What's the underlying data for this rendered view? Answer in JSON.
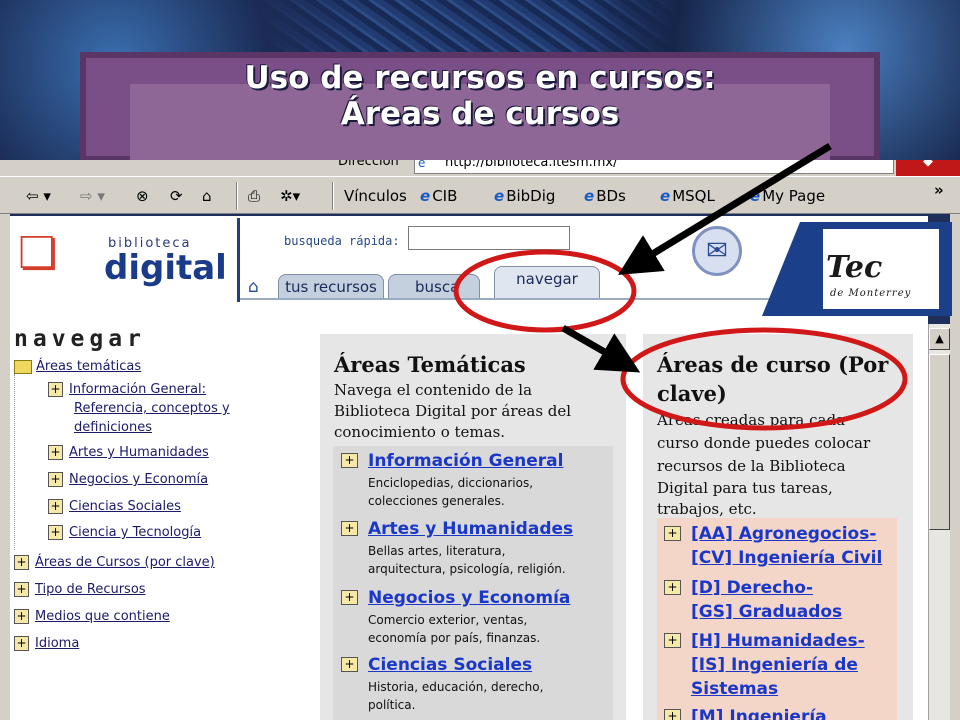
{
  "slide": {
    "title_line1": "Uso de recursos en cursos:",
    "title_line2": "Áreas de cursos"
  },
  "browser": {
    "address_label": "Dirección",
    "address_url": "http://biblioteca.itesm.mx/",
    "toolbar": {
      "links_label": "Vínculos",
      "links": [
        "CIB",
        "BibDig",
        "BDs",
        "MSQL",
        "My Page"
      ],
      "more": "»"
    }
  },
  "header": {
    "logo_small": "biblioteca",
    "logo_big": "digital",
    "quick_search_label": "busqueda rápida:",
    "quick_search_value": "",
    "tabs": [
      "tus recursos",
      "busca",
      "navegar"
    ],
    "active_tab": "navegar",
    "tec_logo": "Tec",
    "tec_sub": "de Monterrey"
  },
  "nav": {
    "title": "navegar",
    "root": "Áreas temáticas",
    "children": [
      {
        "label_lines": [
          "Información General:",
          "Referencia, conceptos y",
          "definiciones"
        ]
      },
      {
        "label_lines": [
          "Artes y Humanidades"
        ]
      },
      {
        "label_lines": [
          "Negocios y Economía"
        ]
      },
      {
        "label_lines": [
          "Ciencias Sociales"
        ]
      },
      {
        "label_lines": [
          "Ciencia y Tecnología"
        ]
      }
    ],
    "folders": [
      "Áreas de Cursos (por clave)",
      "Tipo de Recursos",
      "Medios que contiene",
      "Idioma"
    ]
  },
  "tematicas": {
    "heading": "Áreas Temáticas",
    "intro": [
      "Navega el contenido de la",
      "Biblioteca Digital por áreas del",
      "conocimiento o temas."
    ],
    "items": [
      {
        "title": "Información General",
        "desc": [
          "Enciclopedias, diccionarios,",
          "colecciones generales."
        ]
      },
      {
        "title": "Artes y Humanidades",
        "desc": [
          "Bellas artes, literatura,",
          "arquitectura, psicología, religión."
        ]
      },
      {
        "title": "Negocios y Economía",
        "desc": [
          "Comercio exterior, ventas,",
          "economía por país, finanzas."
        ]
      },
      {
        "title": "Ciencias Sociales",
        "desc": [
          "Historia, educación, derecho,",
          "política."
        ]
      }
    ]
  },
  "curso": {
    "heading_lines": [
      "Áreas de curso (Por",
      "clave)"
    ],
    "intro": [
      "Áreas creadas para cada",
      "curso donde puedes colocar",
      "recursos de la Biblioteca",
      "Digital para tus tareas,",
      "trabajos, etc."
    ],
    "items": [
      [
        "[AA] Agronegocios-",
        "[CV] Ingeniería Civil"
      ],
      [
        "[D] Derecho-",
        "[GS] Graduados"
      ],
      [
        "[H] Humanidades-",
        "[IS] Ingeniería de",
        "Sistemas"
      ],
      [
        "[M] Ingeniería"
      ]
    ]
  },
  "colors": {
    "annotation_circle": "#d01818",
    "link": "#1a37c8",
    "panel_bg": "#e6e6e6",
    "course_list_bg": "#f3d6c8"
  }
}
